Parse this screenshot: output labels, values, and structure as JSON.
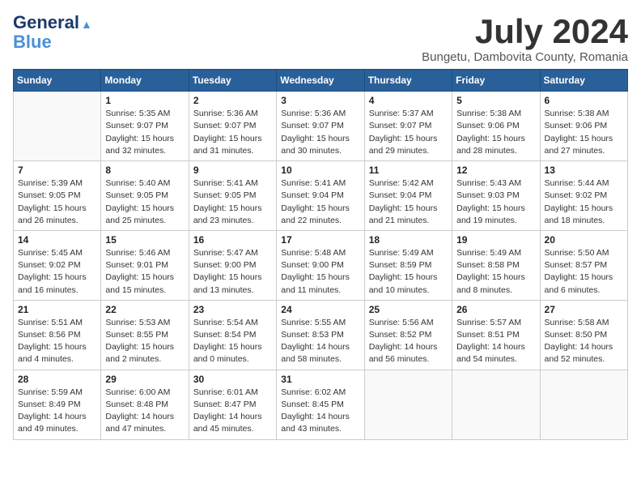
{
  "header": {
    "logo_line1": "General",
    "logo_line2": "Blue",
    "month": "July 2024",
    "location": "Bungetu, Dambovita County, Romania"
  },
  "days_of_week": [
    "Sunday",
    "Monday",
    "Tuesday",
    "Wednesday",
    "Thursday",
    "Friday",
    "Saturday"
  ],
  "weeks": [
    [
      {
        "day": "",
        "sunrise": "",
        "sunset": "",
        "daylight": ""
      },
      {
        "day": "1",
        "sunrise": "Sunrise: 5:35 AM",
        "sunset": "Sunset: 9:07 PM",
        "daylight": "Daylight: 15 hours and 32 minutes."
      },
      {
        "day": "2",
        "sunrise": "Sunrise: 5:36 AM",
        "sunset": "Sunset: 9:07 PM",
        "daylight": "Daylight: 15 hours and 31 minutes."
      },
      {
        "day": "3",
        "sunrise": "Sunrise: 5:36 AM",
        "sunset": "Sunset: 9:07 PM",
        "daylight": "Daylight: 15 hours and 30 minutes."
      },
      {
        "day": "4",
        "sunrise": "Sunrise: 5:37 AM",
        "sunset": "Sunset: 9:07 PM",
        "daylight": "Daylight: 15 hours and 29 minutes."
      },
      {
        "day": "5",
        "sunrise": "Sunrise: 5:38 AM",
        "sunset": "Sunset: 9:06 PM",
        "daylight": "Daylight: 15 hours and 28 minutes."
      },
      {
        "day": "6",
        "sunrise": "Sunrise: 5:38 AM",
        "sunset": "Sunset: 9:06 PM",
        "daylight": "Daylight: 15 hours and 27 minutes."
      }
    ],
    [
      {
        "day": "7",
        "sunrise": "Sunrise: 5:39 AM",
        "sunset": "Sunset: 9:05 PM",
        "daylight": "Daylight: 15 hours and 26 minutes."
      },
      {
        "day": "8",
        "sunrise": "Sunrise: 5:40 AM",
        "sunset": "Sunset: 9:05 PM",
        "daylight": "Daylight: 15 hours and 25 minutes."
      },
      {
        "day": "9",
        "sunrise": "Sunrise: 5:41 AM",
        "sunset": "Sunset: 9:05 PM",
        "daylight": "Daylight: 15 hours and 23 minutes."
      },
      {
        "day": "10",
        "sunrise": "Sunrise: 5:41 AM",
        "sunset": "Sunset: 9:04 PM",
        "daylight": "Daylight: 15 hours and 22 minutes."
      },
      {
        "day": "11",
        "sunrise": "Sunrise: 5:42 AM",
        "sunset": "Sunset: 9:04 PM",
        "daylight": "Daylight: 15 hours and 21 minutes."
      },
      {
        "day": "12",
        "sunrise": "Sunrise: 5:43 AM",
        "sunset": "Sunset: 9:03 PM",
        "daylight": "Daylight: 15 hours and 19 minutes."
      },
      {
        "day": "13",
        "sunrise": "Sunrise: 5:44 AM",
        "sunset": "Sunset: 9:02 PM",
        "daylight": "Daylight: 15 hours and 18 minutes."
      }
    ],
    [
      {
        "day": "14",
        "sunrise": "Sunrise: 5:45 AM",
        "sunset": "Sunset: 9:02 PM",
        "daylight": "Daylight: 15 hours and 16 minutes."
      },
      {
        "day": "15",
        "sunrise": "Sunrise: 5:46 AM",
        "sunset": "Sunset: 9:01 PM",
        "daylight": "Daylight: 15 hours and 15 minutes."
      },
      {
        "day": "16",
        "sunrise": "Sunrise: 5:47 AM",
        "sunset": "Sunset: 9:00 PM",
        "daylight": "Daylight: 15 hours and 13 minutes."
      },
      {
        "day": "17",
        "sunrise": "Sunrise: 5:48 AM",
        "sunset": "Sunset: 9:00 PM",
        "daylight": "Daylight: 15 hours and 11 minutes."
      },
      {
        "day": "18",
        "sunrise": "Sunrise: 5:49 AM",
        "sunset": "Sunset: 8:59 PM",
        "daylight": "Daylight: 15 hours and 10 minutes."
      },
      {
        "day": "19",
        "sunrise": "Sunrise: 5:49 AM",
        "sunset": "Sunset: 8:58 PM",
        "daylight": "Daylight: 15 hours and 8 minutes."
      },
      {
        "day": "20",
        "sunrise": "Sunrise: 5:50 AM",
        "sunset": "Sunset: 8:57 PM",
        "daylight": "Daylight: 15 hours and 6 minutes."
      }
    ],
    [
      {
        "day": "21",
        "sunrise": "Sunrise: 5:51 AM",
        "sunset": "Sunset: 8:56 PM",
        "daylight": "Daylight: 15 hours and 4 minutes."
      },
      {
        "day": "22",
        "sunrise": "Sunrise: 5:53 AM",
        "sunset": "Sunset: 8:55 PM",
        "daylight": "Daylight: 15 hours and 2 minutes."
      },
      {
        "day": "23",
        "sunrise": "Sunrise: 5:54 AM",
        "sunset": "Sunset: 8:54 PM",
        "daylight": "Daylight: 15 hours and 0 minutes."
      },
      {
        "day": "24",
        "sunrise": "Sunrise: 5:55 AM",
        "sunset": "Sunset: 8:53 PM",
        "daylight": "Daylight: 14 hours and 58 minutes."
      },
      {
        "day": "25",
        "sunrise": "Sunrise: 5:56 AM",
        "sunset": "Sunset: 8:52 PM",
        "daylight": "Daylight: 14 hours and 56 minutes."
      },
      {
        "day": "26",
        "sunrise": "Sunrise: 5:57 AM",
        "sunset": "Sunset: 8:51 PM",
        "daylight": "Daylight: 14 hours and 54 minutes."
      },
      {
        "day": "27",
        "sunrise": "Sunrise: 5:58 AM",
        "sunset": "Sunset: 8:50 PM",
        "daylight": "Daylight: 14 hours and 52 minutes."
      }
    ],
    [
      {
        "day": "28",
        "sunrise": "Sunrise: 5:59 AM",
        "sunset": "Sunset: 8:49 PM",
        "daylight": "Daylight: 14 hours and 49 minutes."
      },
      {
        "day": "29",
        "sunrise": "Sunrise: 6:00 AM",
        "sunset": "Sunset: 8:48 PM",
        "daylight": "Daylight: 14 hours and 47 minutes."
      },
      {
        "day": "30",
        "sunrise": "Sunrise: 6:01 AM",
        "sunset": "Sunset: 8:47 PM",
        "daylight": "Daylight: 14 hours and 45 minutes."
      },
      {
        "day": "31",
        "sunrise": "Sunrise: 6:02 AM",
        "sunset": "Sunset: 8:45 PM",
        "daylight": "Daylight: 14 hours and 43 minutes."
      },
      {
        "day": "",
        "sunrise": "",
        "sunset": "",
        "daylight": ""
      },
      {
        "day": "",
        "sunrise": "",
        "sunset": "",
        "daylight": ""
      },
      {
        "day": "",
        "sunrise": "",
        "sunset": "",
        "daylight": ""
      }
    ]
  ]
}
